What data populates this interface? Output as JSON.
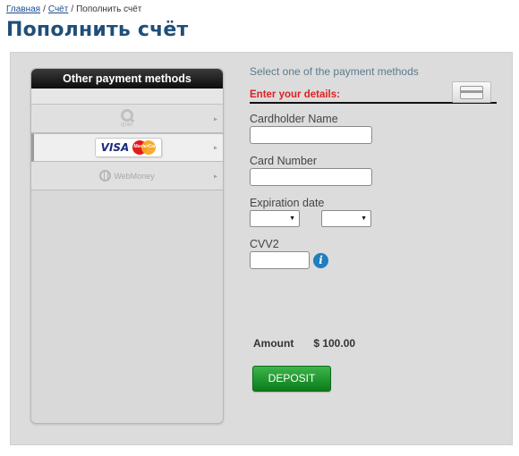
{
  "breadcrumb": {
    "home": "Главная",
    "account": "Счёт",
    "current": "Пополнить счёт",
    "separator": "/"
  },
  "page_title": "Пополнить счёт",
  "sidebar": {
    "title": "Other payment methods",
    "methods": [
      {
        "name": "qiwi",
        "label": "QIWI",
        "icon": "qiwi-logo",
        "active": false
      },
      {
        "name": "visa-mastercard",
        "label_visa": "VISA",
        "label_mc": "MasterCard",
        "icon": "visa-mastercard-logo",
        "active": true
      },
      {
        "name": "webmoney",
        "label": "WebMoney",
        "icon": "webmoney-logo",
        "active": false
      }
    ],
    "arrow_glyph": "▸"
  },
  "form": {
    "select_text": "Select one of the payment methods",
    "details_label": "Enter your details:",
    "cardholder_label": "Cardholder Name",
    "cardholder_value": "",
    "card_number_label": "Card Number",
    "card_number_value": "",
    "expiration_label": "Expiration date",
    "exp_month_value": "",
    "exp_year_value": "",
    "cvv_label": "CVV2",
    "cvv_value": "",
    "info_icon_glyph": "i"
  },
  "amount": {
    "label": "Amount",
    "value": "$ 100.00"
  },
  "deposit_button": "DEPOSIT",
  "colors": {
    "title": "#1f4e79",
    "details_label": "#e02020",
    "deposit": "#1a9a2a",
    "info_icon": "#1f7dc0"
  }
}
